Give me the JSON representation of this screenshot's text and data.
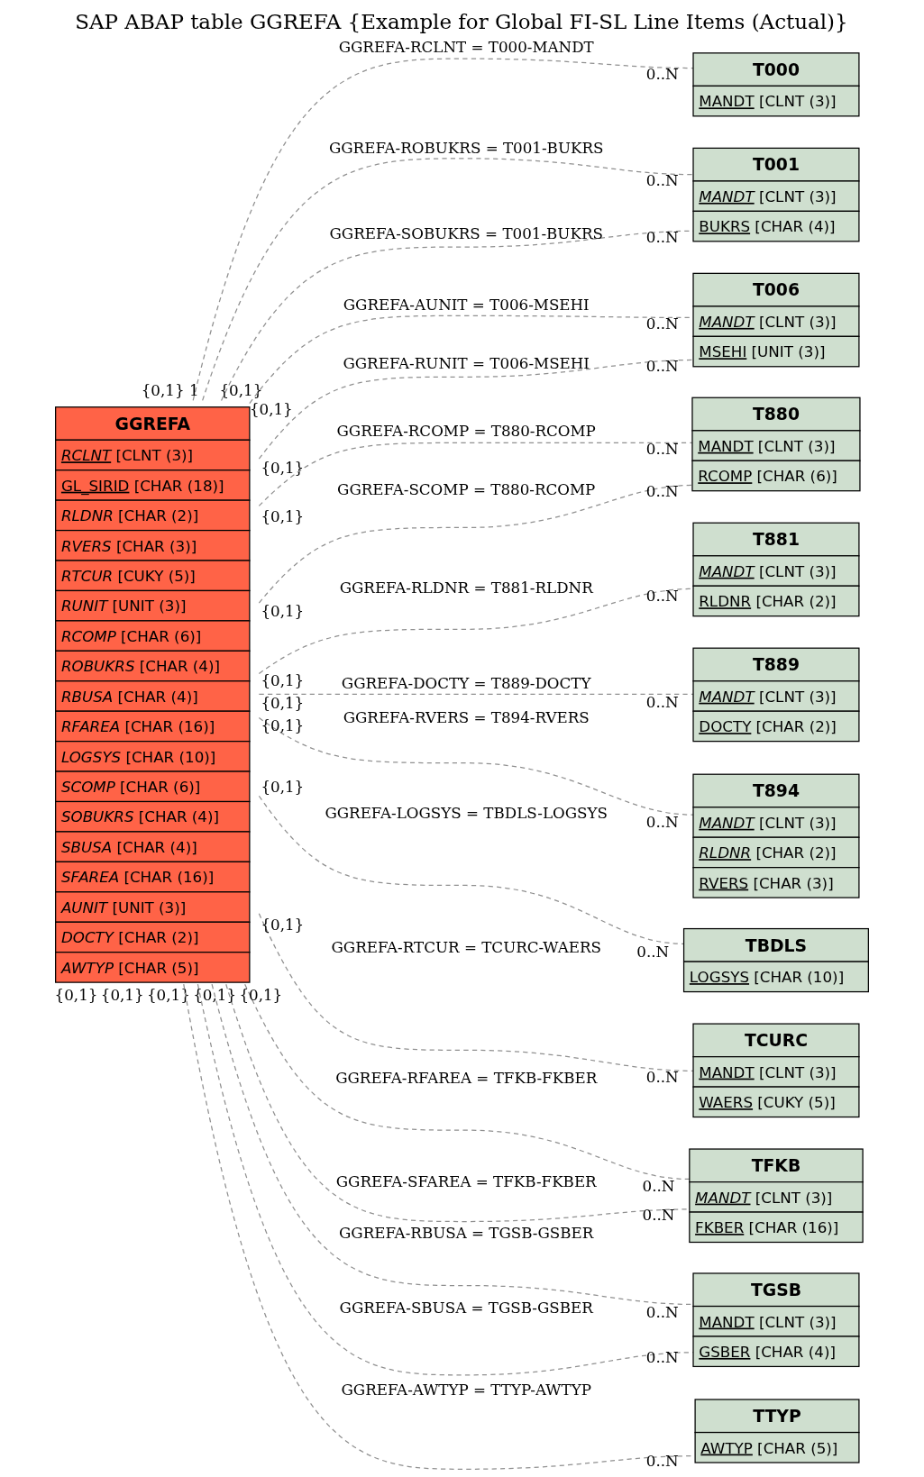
{
  "title": "SAP ABAP table GGREFA {Example for Global FI-SL Line Items (Actual)}",
  "tables": [
    {
      "name": "GGREFA",
      "color": "#ff6347",
      "fields": [
        {
          "name": "RCLNT",
          "type": "[CLNT (3)]",
          "key": true,
          "italic": true
        },
        {
          "name": "GL_SIRID",
          "type": "[CHAR (18)]",
          "key": true,
          "italic": false
        },
        {
          "name": "RLDNR",
          "type": "[CHAR (2)]",
          "key": false,
          "italic": true
        },
        {
          "name": "RVERS",
          "type": "[CHAR (3)]",
          "key": false,
          "italic": true
        },
        {
          "name": "RTCUR",
          "type": "[CUKY (5)]",
          "key": false,
          "italic": true
        },
        {
          "name": "RUNIT",
          "type": "[UNIT (3)]",
          "key": false,
          "italic": true
        },
        {
          "name": "RCOMP",
          "type": "[CHAR (6)]",
          "key": false,
          "italic": true
        },
        {
          "name": "ROBUKRS",
          "type": "[CHAR (4)]",
          "key": false,
          "italic": true
        },
        {
          "name": "RBUSA",
          "type": "[CHAR (4)]",
          "key": false,
          "italic": true
        },
        {
          "name": "RFAREA",
          "type": "[CHAR (16)]",
          "key": false,
          "italic": true
        },
        {
          "name": "LOGSYS",
          "type": "[CHAR (10)]",
          "key": false,
          "italic": true
        },
        {
          "name": "SCOMP",
          "type": "[CHAR (6)]",
          "key": false,
          "italic": true
        },
        {
          "name": "SOBUKRS",
          "type": "[CHAR (4)]",
          "key": false,
          "italic": true
        },
        {
          "name": "SBUSA",
          "type": "[CHAR (4)]",
          "key": false,
          "italic": true
        },
        {
          "name": "SFAREA",
          "type": "[CHAR (16)]",
          "key": false,
          "italic": true
        },
        {
          "name": "AUNIT",
          "type": "[UNIT (3)]",
          "key": false,
          "italic": true
        },
        {
          "name": "DOCTY",
          "type": "[CHAR (2)]",
          "key": false,
          "italic": true
        },
        {
          "name": "AWTYP",
          "type": "[CHAR (5)]",
          "key": false,
          "italic": true
        }
      ]
    },
    {
      "name": "T000",
      "color": "#cfdfcf",
      "fields": [
        {
          "name": "MANDT",
          "type": "[CLNT (3)]",
          "key": true,
          "italic": false
        }
      ]
    },
    {
      "name": "T001",
      "color": "#cfdfcf",
      "fields": [
        {
          "name": "MANDT",
          "type": "[CLNT (3)]",
          "key": true,
          "italic": true
        },
        {
          "name": "BUKRS",
          "type": "[CHAR (4)]",
          "key": true,
          "italic": false
        }
      ]
    },
    {
      "name": "T006",
      "color": "#cfdfcf",
      "fields": [
        {
          "name": "MANDT",
          "type": "[CLNT (3)]",
          "key": true,
          "italic": true
        },
        {
          "name": "MSEHI",
          "type": "[UNIT (3)]",
          "key": true,
          "italic": false
        }
      ]
    },
    {
      "name": "T880",
      "color": "#cfdfcf",
      "fields": [
        {
          "name": "MANDT",
          "type": "[CLNT (3)]",
          "key": true,
          "italic": false
        },
        {
          "name": "RCOMP",
          "type": "[CHAR (6)]",
          "key": true,
          "italic": false
        }
      ]
    },
    {
      "name": "T881",
      "color": "#cfdfcf",
      "fields": [
        {
          "name": "MANDT",
          "type": "[CLNT (3)]",
          "key": true,
          "italic": true
        },
        {
          "name": "RLDNR",
          "type": "[CHAR (2)]",
          "key": true,
          "italic": false
        }
      ]
    },
    {
      "name": "T889",
      "color": "#cfdfcf",
      "fields": [
        {
          "name": "MANDT",
          "type": "[CLNT (3)]",
          "key": true,
          "italic": true
        },
        {
          "name": "DOCTY",
          "type": "[CHAR (2)]",
          "key": true,
          "italic": false
        }
      ]
    },
    {
      "name": "T894",
      "color": "#cfdfcf",
      "fields": [
        {
          "name": "MANDT",
          "type": "[CLNT (3)]",
          "key": true,
          "italic": true
        },
        {
          "name": "RLDNR",
          "type": "[CHAR (2)]",
          "key": true,
          "italic": true
        },
        {
          "name": "RVERS",
          "type": "[CHAR (3)]",
          "key": true,
          "italic": false
        }
      ]
    },
    {
      "name": "TBDLS",
      "color": "#cfdfcf",
      "fields": [
        {
          "name": "LOGSYS",
          "type": "[CHAR (10)]",
          "key": true,
          "italic": false
        }
      ]
    },
    {
      "name": "TCURC",
      "color": "#cfdfcf",
      "fields": [
        {
          "name": "MANDT",
          "type": "[CLNT (3)]",
          "key": true,
          "italic": false
        },
        {
          "name": "WAERS",
          "type": "[CUKY (5)]",
          "key": true,
          "italic": false
        }
      ]
    },
    {
      "name": "TFKB",
      "color": "#cfdfcf",
      "fields": [
        {
          "name": "MANDT",
          "type": "[CLNT (3)]",
          "key": true,
          "italic": true
        },
        {
          "name": "FKBER",
          "type": "[CHAR (16)]",
          "key": true,
          "italic": false
        }
      ]
    },
    {
      "name": "TGSB",
      "color": "#cfdfcf",
      "fields": [
        {
          "name": "MANDT",
          "type": "[CLNT (3)]",
          "key": true,
          "italic": false
        },
        {
          "name": "GSBER",
          "type": "[CHAR (4)]",
          "key": true,
          "italic": false
        }
      ]
    },
    {
      "name": "TTYP",
      "color": "#cfdfcf",
      "fields": [
        {
          "name": "AWTYP",
          "type": "[CHAR (5)]",
          "key": true,
          "italic": false
        }
      ]
    }
  ],
  "relations": [
    {
      "label": "GGREFA-RCLNT = T000-MANDT",
      "from_card": "{0,1}",
      "to_card": "0..N"
    },
    {
      "label": "GGREFA-ROBUKRS = T001-BUKRS",
      "from_card": "1",
      "to_card": "0..N"
    },
    {
      "label": "GGREFA-SOBUKRS = T001-BUKRS",
      "from_card": "{0,1}",
      "to_card": "0..N"
    },
    {
      "label": "GGREFA-AUNIT = T006-MSEHI",
      "from_card": "{0,1}",
      "to_card": "0..N"
    },
    {
      "label": "GGREFA-RUNIT = T006-MSEHI",
      "from_card": "{0,1}",
      "to_card": "0..N"
    },
    {
      "label": "GGREFA-RCOMP = T880-RCOMP",
      "from_card": "{0,1}",
      "to_card": "0..N"
    },
    {
      "label": "GGREFA-SCOMP = T880-RCOMP",
      "from_card": "{0,1}",
      "to_card": "0..N"
    },
    {
      "label": "GGREFA-RLDNR = T881-RLDNR",
      "from_card": "{0,1}",
      "to_card": "0..N"
    },
    {
      "label": "GGREFA-DOCTY = T889-DOCTY",
      "from_card": "{0,1}",
      "to_card": "0..N"
    },
    {
      "label": "GGREFA-RVERS = T894-RVERS",
      "from_card": "{0,1}",
      "to_card": "0..N"
    },
    {
      "label": "GGREFA-LOGSYS = TBDLS-LOGSYS",
      "from_card": "{0,1}",
      "to_card": "0..N"
    },
    {
      "label": "GGREFA-RTCUR = TCURC-WAERS",
      "from_card": "{0,1}",
      "to_card": "0..N"
    },
    {
      "label": "GGREFA-RFAREA = TFKB-FKBER",
      "from_card": "{0,1}",
      "to_card": "0..N"
    },
    {
      "label": "GGREFA-SFAREA = TFKB-FKBER",
      "from_card": "{0,1}",
      "to_card": "0..N"
    },
    {
      "label": "GGREFA-RBUSA = TGSB-GSBER",
      "from_card": "{0,1}",
      "to_card": "0..N"
    },
    {
      "label": "GGREFA-SBUSA = TGSB-GSBER",
      "from_card": "{0,1}",
      "to_card": "0..N"
    },
    {
      "label": "GGREFA-AWTYP = TTYP-AWTYP",
      "from_card": "{0,1}",
      "to_card": "0..N"
    }
  ]
}
